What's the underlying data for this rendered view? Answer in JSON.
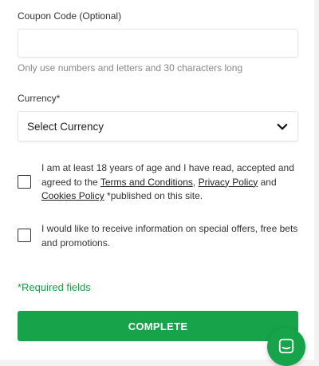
{
  "coupon": {
    "label": "Coupon Code (Optional)",
    "value": "",
    "placeholder": "",
    "hint": "Only use numbers and letters and 30 characters long"
  },
  "currency": {
    "label": "Currency*",
    "selected": "Select Currency",
    "icon": "chevron-down-icon"
  },
  "terms": {
    "checked": false,
    "text_before": "I am at least 18 years of age and I have read, accepted and agreed to the ",
    "link_terms": "Terms and Conditions",
    "sep1": ", ",
    "link_privacy": "Privacy Policy",
    "sep2": " and ",
    "link_cookies": "Cookies Policy",
    "text_after": " *published on this site."
  },
  "offers": {
    "checked": false,
    "text": "I would like to receive information on special offers, free bets and promotions."
  },
  "required_note": "*Required fields",
  "complete_label": "COMPLETE",
  "chat": {
    "icon": "chat-icon"
  },
  "colors": {
    "accent": "#16a34a",
    "required_text": "#1a9e47",
    "hint_text": "#888888"
  }
}
